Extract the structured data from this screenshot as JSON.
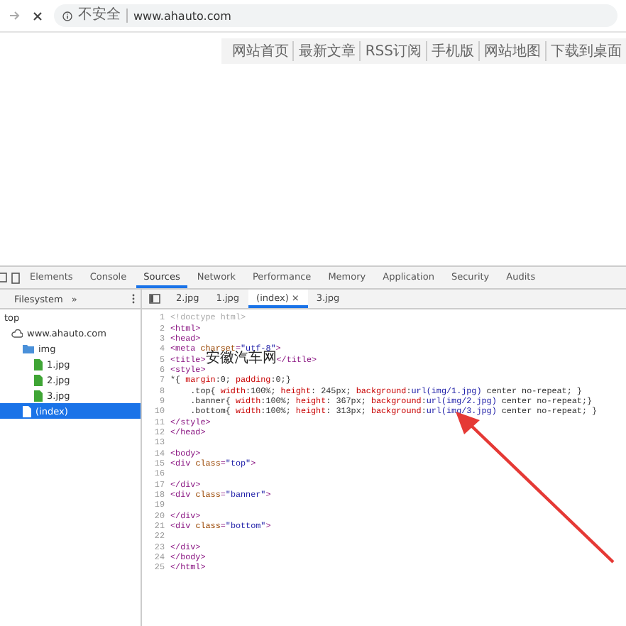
{
  "address_bar": {
    "security_label": "不安全",
    "url": "www.ahauto.com"
  },
  "site_nav": [
    "网站首页",
    "最新文章",
    "RSS订阅",
    "手机版",
    "网站地图",
    "下载到桌面"
  ],
  "devtools": {
    "tabs": [
      {
        "label": "Elements",
        "selected": false
      },
      {
        "label": "Console",
        "selected": false
      },
      {
        "label": "Sources",
        "selected": true
      },
      {
        "label": "Network",
        "selected": false
      },
      {
        "label": "Performance",
        "selected": false
      },
      {
        "label": "Memory",
        "selected": false
      },
      {
        "label": "Application",
        "selected": false
      },
      {
        "label": "Security",
        "selected": false
      },
      {
        "label": "Audits",
        "selected": false
      }
    ],
    "navigator": {
      "tab": "Filesystem",
      "more": "»",
      "tree": [
        {
          "label": "top",
          "kind": "frame",
          "selected": false,
          "children": [
            {
              "label": "www.ahauto.com",
              "kind": "cloud",
              "selected": false,
              "children": [
                {
                  "label": "img",
                  "kind": "folder",
                  "selected": false,
                  "children": [
                    {
                      "label": "1.jpg",
                      "kind": "image",
                      "selected": false
                    },
                    {
                      "label": "2.jpg",
                      "kind": "image",
                      "selected": false
                    },
                    {
                      "label": "3.jpg",
                      "kind": "image",
                      "selected": false
                    }
                  ]
                },
                {
                  "label": "(index)",
                  "kind": "document",
                  "selected": true
                }
              ]
            }
          ]
        }
      ]
    },
    "editor_tabs": [
      {
        "label": "2.jpg",
        "selected": false,
        "closable": false
      },
      {
        "label": "1.jpg",
        "selected": false,
        "closable": false
      },
      {
        "label": "(index)",
        "selected": true,
        "closable": true
      },
      {
        "label": "3.jpg",
        "selected": false,
        "closable": false
      }
    ],
    "close_glyph": "×",
    "code_lines": [
      {
        "number": "1",
        "segments": [
          {
            "kind": "comment",
            "text": "<!doctype html>"
          }
        ]
      },
      {
        "number": "2",
        "segments": [
          {
            "kind": "tag",
            "text": "<html>"
          }
        ]
      },
      {
        "number": "3",
        "segments": [
          {
            "kind": "tag",
            "text": "<head>"
          }
        ]
      },
      {
        "number": "4",
        "segments": [
          {
            "kind": "tag",
            "text": "<meta "
          },
          {
            "kind": "attr",
            "text": "charset"
          },
          {
            "kind": "tag",
            "text": "="
          },
          {
            "kind": "value",
            "text": "\"utf-8\""
          },
          {
            "kind": "tag",
            "text": ">"
          }
        ]
      },
      {
        "number": "5",
        "segments": [
          {
            "kind": "tag",
            "text": "<title>"
          },
          {
            "kind": "cjk",
            "text": "安徽汽车网"
          },
          {
            "kind": "tag",
            "text": "</title>"
          }
        ]
      },
      {
        "number": "6",
        "segments": [
          {
            "kind": "tag",
            "text": "<style>"
          }
        ]
      },
      {
        "number": "7",
        "segments": [
          {
            "kind": "plain",
            "text": "*{ "
          },
          {
            "kind": "prop",
            "text": "margin"
          },
          {
            "kind": "plain",
            "text": ":0; "
          },
          {
            "kind": "prop",
            "text": "padding"
          },
          {
            "kind": "plain",
            "text": ":0;}"
          }
        ]
      },
      {
        "number": "8",
        "segments": [
          {
            "kind": "plain",
            "text": "    .top{ "
          },
          {
            "kind": "prop",
            "text": "width"
          },
          {
            "kind": "plain",
            "text": ":100%; "
          },
          {
            "kind": "prop",
            "text": "height"
          },
          {
            "kind": "plain",
            "text": ": 245px; "
          },
          {
            "kind": "prop",
            "text": "background"
          },
          {
            "kind": "plain",
            "text": ":"
          },
          {
            "kind": "value",
            "text": "url(img/1.jpg)"
          },
          {
            "kind": "plain",
            "text": " center no-repeat; }"
          }
        ]
      },
      {
        "number": "9",
        "segments": [
          {
            "kind": "plain",
            "text": "    .banner{ "
          },
          {
            "kind": "prop",
            "text": "width"
          },
          {
            "kind": "plain",
            "text": ":100%; "
          },
          {
            "kind": "prop",
            "text": "height"
          },
          {
            "kind": "plain",
            "text": ": 367px; "
          },
          {
            "kind": "prop",
            "text": "background"
          },
          {
            "kind": "plain",
            "text": ":"
          },
          {
            "kind": "value",
            "text": "url(img/2.jpg)"
          },
          {
            "kind": "plain",
            "text": " center no-repeat;}"
          }
        ]
      },
      {
        "number": "10",
        "segments": [
          {
            "kind": "plain",
            "text": "    .bottom{ "
          },
          {
            "kind": "prop",
            "text": "width"
          },
          {
            "kind": "plain",
            "text": ":100%; "
          },
          {
            "kind": "prop",
            "text": "height"
          },
          {
            "kind": "plain",
            "text": ": 313px; "
          },
          {
            "kind": "prop",
            "text": "background"
          },
          {
            "kind": "plain",
            "text": ":"
          },
          {
            "kind": "value",
            "text": "url(img/3.jpg)"
          },
          {
            "kind": "plain",
            "text": " center no-repeat; }"
          }
        ]
      },
      {
        "number": "11",
        "segments": [
          {
            "kind": "tag",
            "text": "</style>"
          }
        ]
      },
      {
        "number": "12",
        "segments": [
          {
            "kind": "tag",
            "text": "</head>"
          }
        ]
      },
      {
        "number": "13"
      },
      {
        "number": "14",
        "segments": [
          {
            "kind": "tag",
            "text": "<body>"
          }
        ]
      },
      {
        "number": "15",
        "segments": [
          {
            "kind": "tag",
            "text": "<div "
          },
          {
            "kind": "attr",
            "text": "class"
          },
          {
            "kind": "tag",
            "text": "="
          },
          {
            "kind": "value",
            "text": "\"top\""
          },
          {
            "kind": "tag",
            "text": ">"
          }
        ]
      },
      {
        "number": "16"
      },
      {
        "number": "17",
        "segments": [
          {
            "kind": "tag",
            "text": "</div>"
          }
        ]
      },
      {
        "number": "18",
        "segments": [
          {
            "kind": "tag",
            "text": "<div "
          },
          {
            "kind": "attr",
            "text": "class"
          },
          {
            "kind": "tag",
            "text": "="
          },
          {
            "kind": "value",
            "text": "\"banner\""
          },
          {
            "kind": "tag",
            "text": ">"
          }
        ]
      },
      {
        "number": "19"
      },
      {
        "number": "20",
        "segments": [
          {
            "kind": "tag",
            "text": "</div>"
          }
        ]
      },
      {
        "number": "21",
        "segments": [
          {
            "kind": "tag",
            "text": "<div "
          },
          {
            "kind": "attr",
            "text": "class"
          },
          {
            "kind": "tag",
            "text": "="
          },
          {
            "kind": "value",
            "text": "\"bottom\""
          },
          {
            "kind": "tag",
            "text": ">"
          }
        ]
      },
      {
        "number": "22"
      },
      {
        "number": "23",
        "segments": [
          {
            "kind": "tag",
            "text": "</div>"
          }
        ]
      },
      {
        "number": "24",
        "segments": [
          {
            "kind": "tag",
            "text": "</body>"
          }
        ]
      },
      {
        "number": "25",
        "segments": [
          {
            "kind": "tag",
            "text": "</html>"
          }
        ]
      }
    ]
  }
}
